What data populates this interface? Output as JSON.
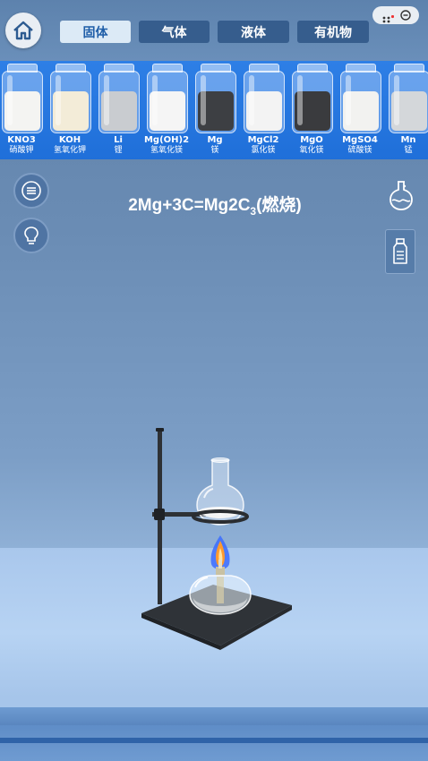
{
  "tabs": [
    {
      "label": "固体",
      "active": true
    },
    {
      "label": "气体",
      "active": false
    },
    {
      "label": "液体",
      "active": false
    },
    {
      "label": "有机物",
      "active": false
    }
  ],
  "reagents": [
    {
      "formula": "KNO3",
      "name": "硝酸钾",
      "color": "#f4f4f2"
    },
    {
      "formula": "KOH",
      "name": "氢氧化钾",
      "color": "#f3ecd8"
    },
    {
      "formula": "Li",
      "name": "锂",
      "color": "#c9ccd0"
    },
    {
      "formula": "Mg(OH)2",
      "name": "氢氧化镁",
      "color": "#f5f5f5"
    },
    {
      "formula": "Mg",
      "name": "镁",
      "color": "#3d3f43"
    },
    {
      "formula": "MgCl2",
      "name": "氯化镁",
      "color": "#f3f3f3"
    },
    {
      "formula": "MgO",
      "name": "氧化镁",
      "color": "#3a3b3e"
    },
    {
      "formula": "MgSO4",
      "name": "硫酸镁",
      "color": "#f2f2f0"
    },
    {
      "formula": "Mn",
      "name": "锰",
      "color": "#d4d7da"
    }
  ],
  "equation": {
    "left": "2Mg+3C=Mg2C",
    "subscript": "3",
    "right": "(燃烧)"
  },
  "icons": {
    "home": "home-icon",
    "menu": "menu-icon",
    "hint": "lightbulb-icon",
    "flask": "flask-icon",
    "bottle": "bottle-icon",
    "more": "more-icon",
    "close": "close-circle-icon"
  },
  "colors": {
    "active_tab_bg": "#dceaf6",
    "active_tab_text": "#1f5ea8",
    "tab_bg": "#365d8d",
    "shelf": "#2874e0",
    "bench": "#b0cdf0",
    "flame_blue": "#3b6cff",
    "flame_orange": "#ff9a2e"
  }
}
